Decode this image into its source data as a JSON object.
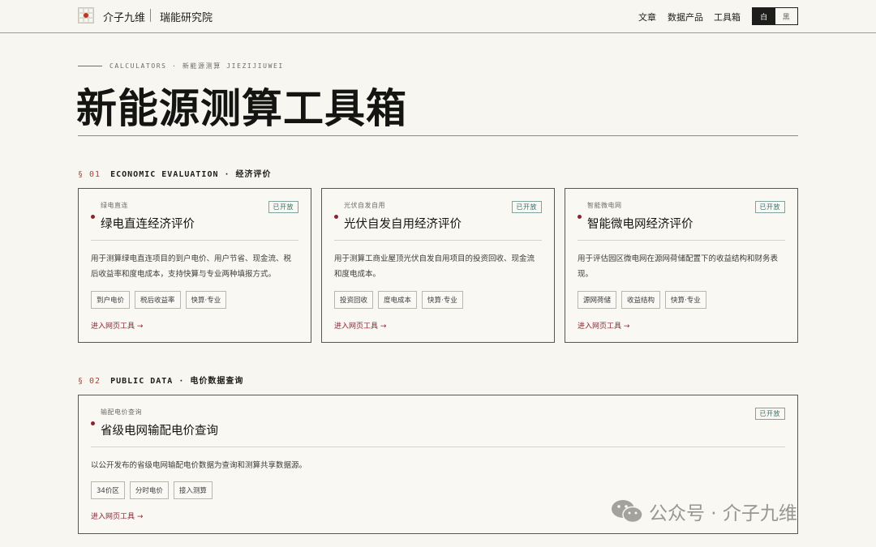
{
  "header": {
    "brand": "介子九维",
    "brand_sub": "瑞能研究院",
    "nav": [
      "文章",
      "数据产品",
      "工具箱"
    ],
    "theme": {
      "light": "白",
      "dark": "黑"
    }
  },
  "hero": {
    "eyebrow": "CALCULATORS · 新能源测算 JIEZIJIUWEI",
    "title": "新能源测算工具箱"
  },
  "sections": [
    {
      "num": "§ 01",
      "title": "ECONOMIC EVALUATION · 经济评价",
      "cards": [
        {
          "eyebrow": "绿电直连",
          "title": "绿电直连经济评价",
          "badge": "已开放",
          "desc": "用于测算绿电直连项目的到户电价、用户节省、现金流、税后收益率和度电成本，支持快算与专业两种填报方式。",
          "tags": [
            "到户电价",
            "税后收益率",
            "快算·专业"
          ],
          "link": "进入网页工具 →"
        },
        {
          "eyebrow": "光伏自发自用",
          "title": "光伏自发自用经济评价",
          "badge": "已开放",
          "desc": "用于测算工商业屋顶光伏自发自用项目的投资回收、现金流和度电成本。",
          "tags": [
            "投资回收",
            "度电成本",
            "快算·专业"
          ],
          "link": "进入网页工具 →"
        },
        {
          "eyebrow": "智能微电网",
          "title": "智能微电网经济评价",
          "badge": "已开放",
          "desc": "用于评估园区微电网在源网荷储配置下的收益结构和财务表现。",
          "tags": [
            "源网荷储",
            "收益结构",
            "快算·专业"
          ],
          "link": "进入网页工具 →"
        }
      ]
    },
    {
      "num": "§ 02",
      "title": "PUBLIC DATA · 电价数据查询",
      "cards": [
        {
          "eyebrow": "输配电价查询",
          "title": "省级电网输配电价查询",
          "badge": "已开放",
          "desc": "以公开发布的省级电网输配电价数据为查询和测算共享数据源。",
          "tags": [
            "34价区",
            "分时电价",
            "接入测算"
          ],
          "link": "进入网页工具 →"
        }
      ]
    }
  ],
  "watermark": "公众号 · 介子九维"
}
